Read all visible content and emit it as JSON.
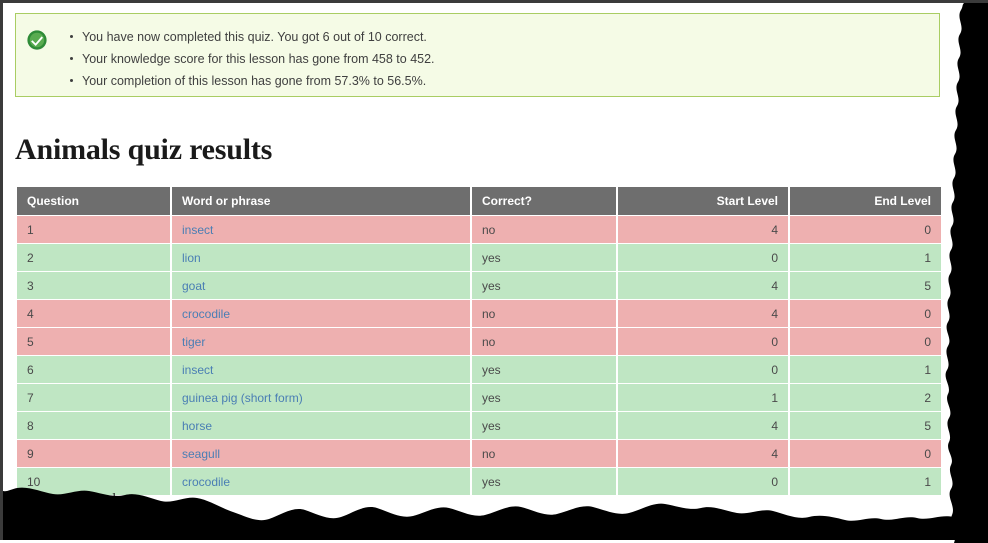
{
  "alert": {
    "icon": "success-check-icon",
    "accent_color": "#a9cd63",
    "background_color": "#f5fbe6",
    "messages": [
      "You have now completed this quiz. You got 6 out of 10 correct.",
      "Your knowledge score for this lesson has gone from 458 to 452.",
      "Your completion of this lesson has gone from 57.3% to 56.5%."
    ]
  },
  "page": {
    "title": "Animals quiz results"
  },
  "table": {
    "colors": {
      "header_background": "#6e6e6e",
      "correct_row": "#bfe6c3",
      "wrong_row": "#eeb0b0",
      "link": "#4a7eb4"
    },
    "columns": [
      {
        "label": "Question",
        "align": "left"
      },
      {
        "label": "Word or phrase",
        "align": "left"
      },
      {
        "label": "Correct?",
        "align": "left"
      },
      {
        "label": "Start Level",
        "align": "right"
      },
      {
        "label": "End Level",
        "align": "right"
      }
    ],
    "rows": [
      {
        "question": "1",
        "word": "insect",
        "correct": "no",
        "start_level": "4",
        "end_level": "0"
      },
      {
        "question": "2",
        "word": "lion",
        "correct": "yes",
        "start_level": "0",
        "end_level": "1"
      },
      {
        "question": "3",
        "word": "goat",
        "correct": "yes",
        "start_level": "4",
        "end_level": "5"
      },
      {
        "question": "4",
        "word": "crocodile",
        "correct": "no",
        "start_level": "4",
        "end_level": "0"
      },
      {
        "question": "5",
        "word": "tiger",
        "correct": "no",
        "start_level": "0",
        "end_level": "0"
      },
      {
        "question": "6",
        "word": "insect",
        "correct": "yes",
        "start_level": "0",
        "end_level": "1"
      },
      {
        "question": "7",
        "word": "guinea pig (short form)",
        "correct": "yes",
        "start_level": "1",
        "end_level": "2"
      },
      {
        "question": "8",
        "word": "horse",
        "correct": "yes",
        "start_level": "4",
        "end_level": "5"
      },
      {
        "question": "9",
        "word": "seagull",
        "correct": "no",
        "start_level": "4",
        "end_level": "0"
      },
      {
        "question": "10",
        "word": "crocodile",
        "correct": "yes",
        "start_level": "0",
        "end_level": "1"
      }
    ]
  },
  "footer": {
    "obscured_text": "words"
  }
}
